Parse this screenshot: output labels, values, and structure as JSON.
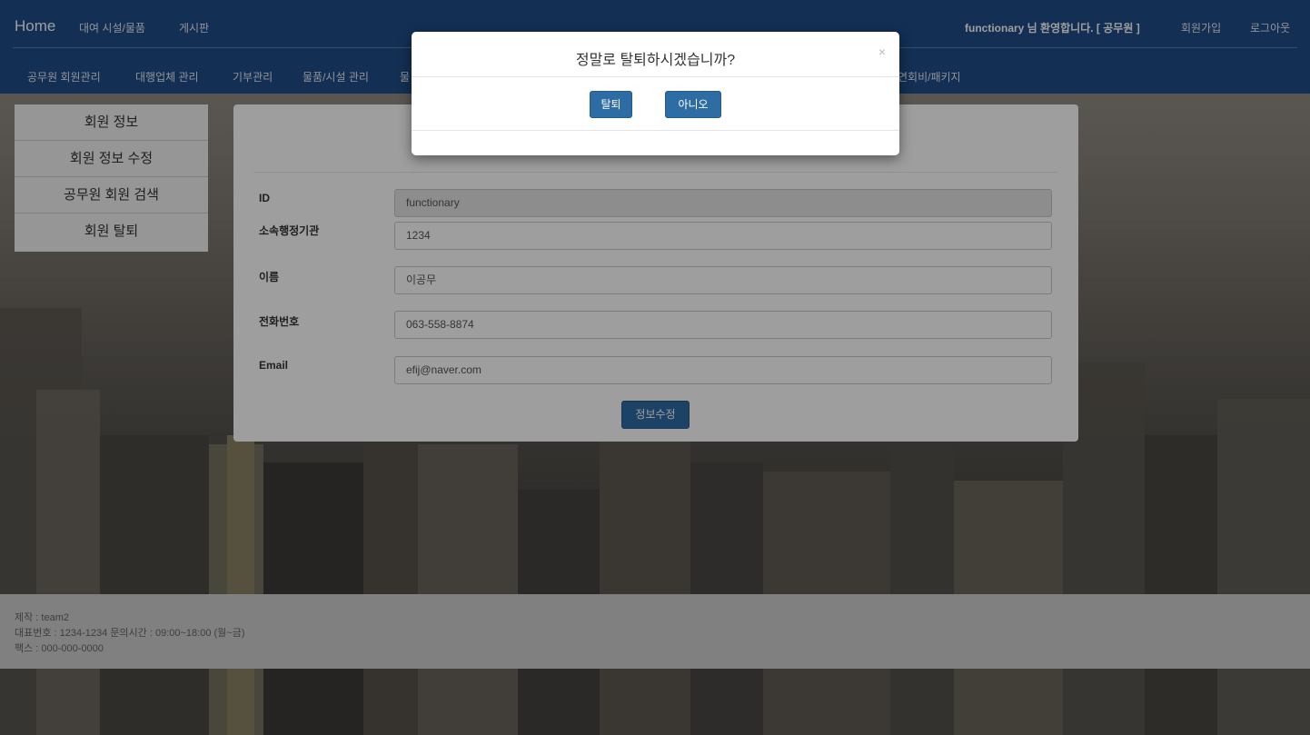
{
  "nav": {
    "brand": "Home",
    "top_links": [
      "대여 시설/물품",
      "게시판"
    ],
    "welcome": "functionary 님 환영합니다. [ 공무원 ]",
    "right_links": [
      "회원가입",
      "로그아웃"
    ],
    "sub_links": [
      "공무원 회원관리",
      "대행업체 관리",
      "기부관리",
      "물품/시설 관리",
      "물",
      "연회비/패키지"
    ]
  },
  "sidebar": {
    "items": [
      {
        "label": "회원 정보"
      },
      {
        "label": "회원 정보 수정"
      },
      {
        "label": "공무원 회원 검색"
      },
      {
        "label": "회원 탈퇴"
      }
    ]
  },
  "form": {
    "fields": [
      {
        "label": "ID",
        "value": "functionary"
      },
      {
        "label": "소속행정기관",
        "value": "1234"
      },
      {
        "label": "이름",
        "value": "이공무"
      },
      {
        "label": "전화번호",
        "value": "063-558-8874"
      },
      {
        "label": "Email",
        "value": "efij@naver.com"
      }
    ],
    "submit_label": "정보수정"
  },
  "footer": {
    "lines": [
      "제작 : team2",
      "대표번호 : 1234-1234 문의시간 : 09:00~18:00 (월~금)",
      "팩스 : 000-000-0000"
    ]
  },
  "modal": {
    "title": "정말로 탈퇴하시겠습니까?",
    "close_glyph": "×",
    "confirm_label": "탈퇴",
    "cancel_label": "아니오"
  },
  "colors": {
    "navbar": "#1f4c88",
    "button_primary": "#2e6da4",
    "footer": "#cfcfcf"
  }
}
